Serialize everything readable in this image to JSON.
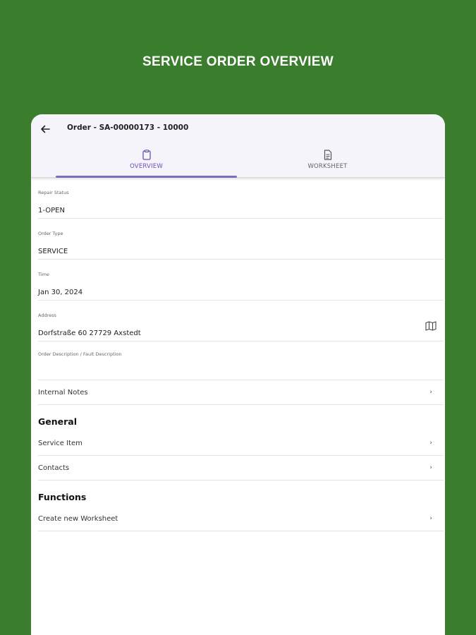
{
  "banner": {
    "title": "SERVICE ORDER OVERVIEW"
  },
  "appbar": {
    "title": "Order - SA-00000173 - 10000"
  },
  "tabs": [
    {
      "label": "OVERVIEW",
      "icon": "clipboard-icon",
      "selected": true
    },
    {
      "label": "WORKSHEET",
      "icon": "document-icon",
      "selected": false
    }
  ],
  "fields": {
    "repair_status": {
      "label": "Repair Status",
      "value": "1-OPEN"
    },
    "order_type": {
      "label": "Order Type",
      "value": "SERVICE"
    },
    "time": {
      "label": "Time",
      "value": "Jan 30, 2024"
    },
    "address": {
      "label": "Address",
      "value": "Dorfstraße 60 27729 Axstedt"
    },
    "description": {
      "label": "Order Description / Fault Description",
      "value": ""
    }
  },
  "internal_notes": {
    "label": "Internal Notes"
  },
  "general": {
    "title": "General",
    "items": [
      {
        "label": "Service Item"
      },
      {
        "label": "Contacts"
      }
    ]
  },
  "functions": {
    "title": "Functions",
    "items": [
      {
        "label": "Create new Worksheet"
      }
    ]
  },
  "chevron": "›",
  "colors": {
    "background": "#3a7d2c",
    "accent": "#7e6bbd",
    "appbar": "#f6f4fb"
  }
}
